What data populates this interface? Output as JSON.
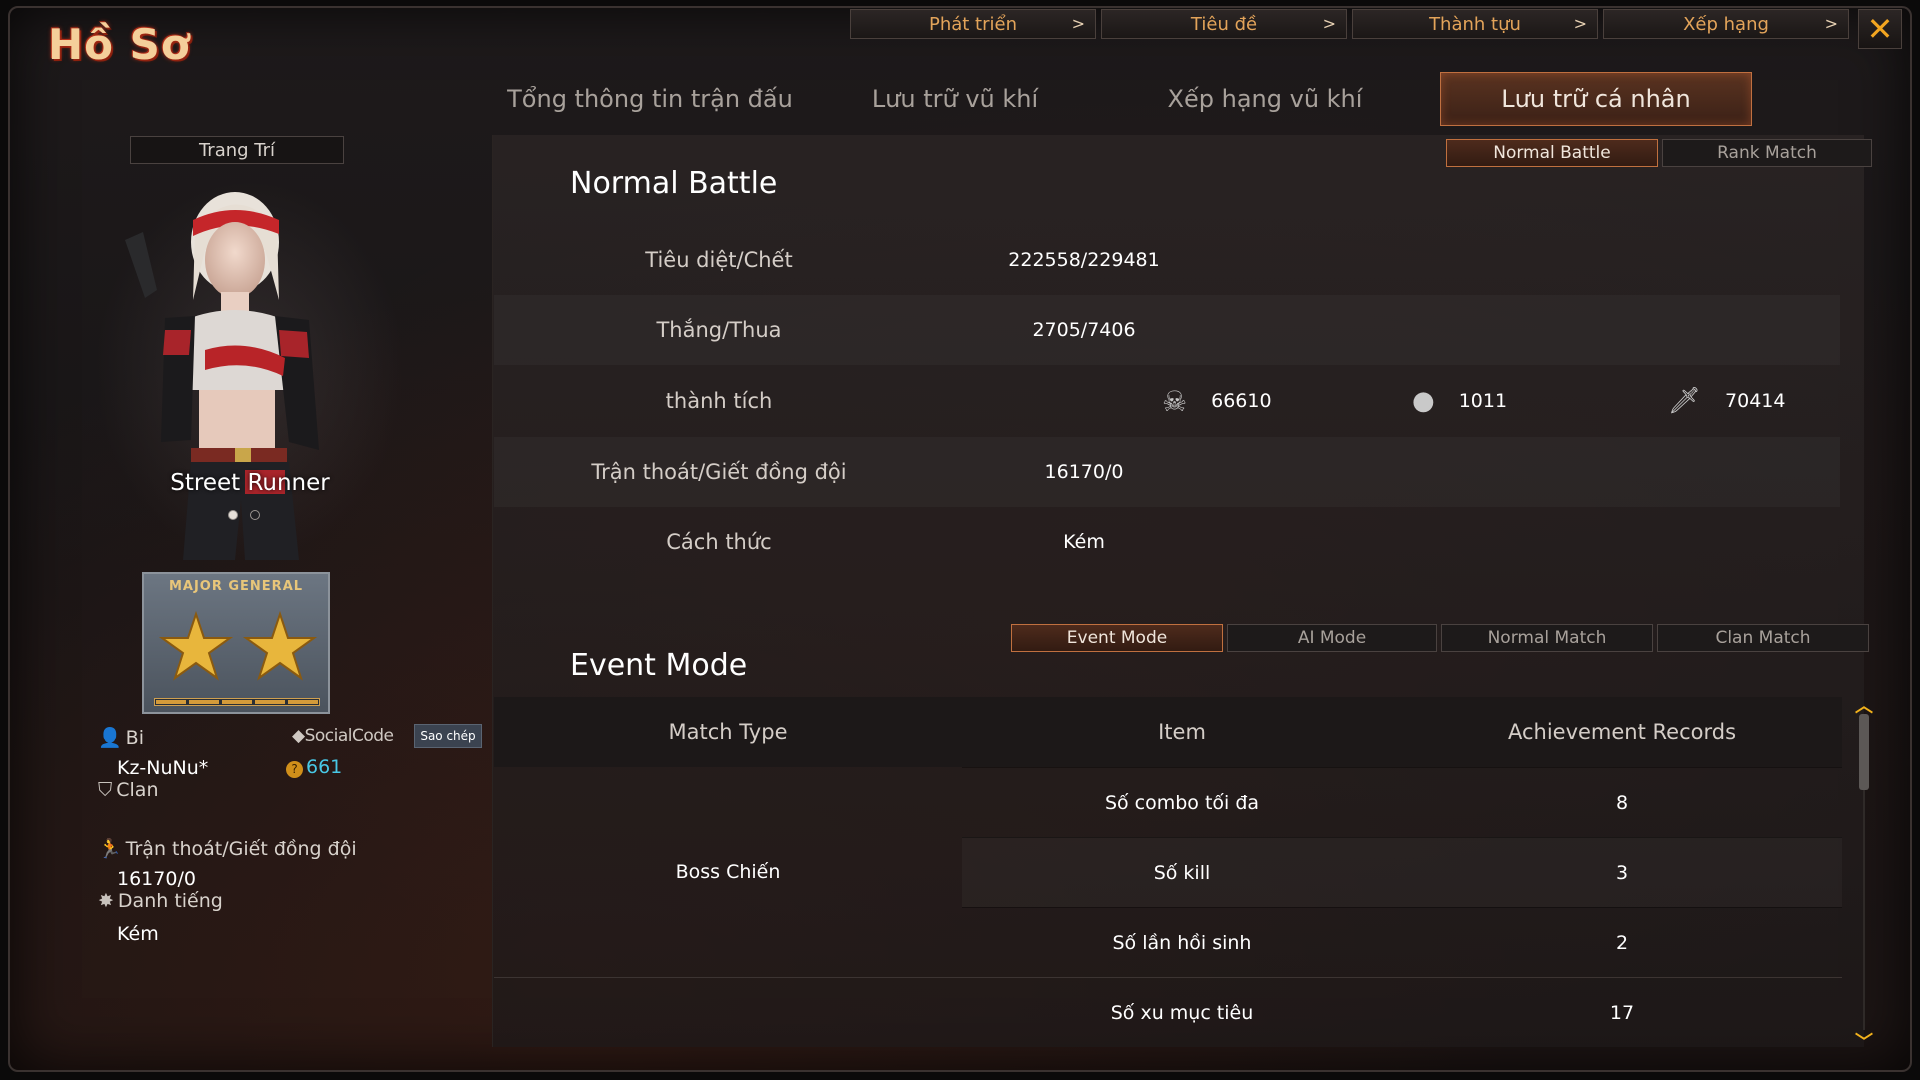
{
  "window": {
    "title": "Hồ Sơ",
    "close_icon": "close-icon"
  },
  "topnav": [
    {
      "label": "Phát triển",
      "chev": ">"
    },
    {
      "label": "Tiêu đề",
      "chev": ">"
    },
    {
      "label": "Thành tựu",
      "chev": ">"
    },
    {
      "label": "Xếp hạng",
      "chev": ">"
    }
  ],
  "maintabs": [
    {
      "label": "Tổng thông tin trận đấu",
      "active": false
    },
    {
      "label": "Lưu trữ vũ khí",
      "active": false
    },
    {
      "label": "Xếp hạng vũ khí",
      "active": false
    },
    {
      "label": "Lưu trữ cá nhân",
      "active": true
    }
  ],
  "profile": {
    "decorate_label": "Trang Trí",
    "character_name": "Street Runner",
    "rank_text": "MAJOR GENERAL",
    "bi_label": "Bi",
    "social_label": "SocialCode",
    "copy_label": "Sao chép",
    "player_name": "Kz-NuNu*",
    "coin_value": "661",
    "clan_label": "Clan",
    "escape_label": "Trận thoát/Giết đồng đội",
    "escape_value": "16170/0",
    "reputation_label": "Danh tiếng",
    "reputation_value": "Kém"
  },
  "battle_tabs": [
    {
      "label": "Normal Battle",
      "active": true
    },
    {
      "label": "Rank Match",
      "active": false
    }
  ],
  "normal_battle": {
    "title": "Normal Battle",
    "rows": [
      {
        "label": "Tiêu diệt/Chết",
        "value": "222558/229481"
      },
      {
        "label": "Thắng/Thua",
        "value": "2705/7406"
      },
      {
        "label": "thành tích",
        "value": ""
      },
      {
        "label": "Trận thoát/Giết đồng đội",
        "value": "16170/0"
      },
      {
        "label": "Cách thức",
        "value": "Kém"
      }
    ],
    "achievements": [
      {
        "icon": "skull-crossbones-icon",
        "value": "66610"
      },
      {
        "icon": "grenade-icon",
        "value": "1011"
      },
      {
        "icon": "knife-icon",
        "value": "70414"
      }
    ]
  },
  "mode_tabs": [
    {
      "label": "Event Mode",
      "active": true
    },
    {
      "label": "AI Mode",
      "active": false
    },
    {
      "label": "Normal Match",
      "active": false
    },
    {
      "label": "Clan Match",
      "active": false
    }
  ],
  "event_mode": {
    "title": "Event Mode",
    "headers": [
      "Match Type",
      "Item",
      "Achievement Records"
    ],
    "match_type": "Boss Chiến",
    "rows": [
      {
        "item": "Số combo tối đa",
        "record": "8"
      },
      {
        "item": "Số kill",
        "record": "3"
      },
      {
        "item": "Số lần hồi sinh",
        "record": "2"
      },
      {
        "item": "Số xu mục tiêu",
        "record": "17"
      }
    ]
  },
  "colors": {
    "accent": "#c0703f",
    "title": "#f4cf9a",
    "topnav_text": "#e3a45a",
    "coin": "#48c8e6",
    "close": "#f2a520"
  }
}
